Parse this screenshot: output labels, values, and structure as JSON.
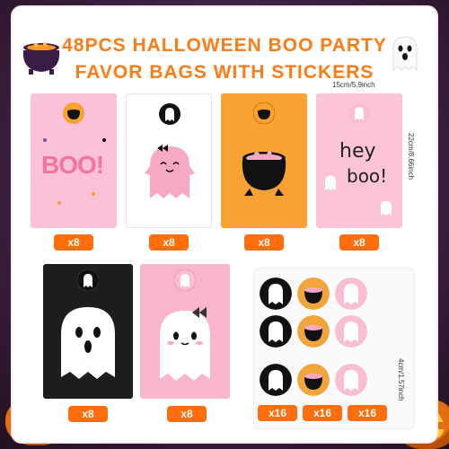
{
  "title": {
    "line1": "48PCS HALLOWEEN BOO PARTY",
    "line2": "FAVOR BAGS WITH STICKERS"
  },
  "dimensions": {
    "width": "15cm/5.9inch",
    "height": "22cm/8.66inch",
    "sticker": "4cm/1.57inch"
  },
  "bags_row1": [
    {
      "design": "boo-text",
      "color": "#fbc1d8",
      "qty": "x8"
    },
    {
      "design": "ghost-bow",
      "color": "#ffffff",
      "qty": "x8"
    },
    {
      "design": "cauldron",
      "color": "#f7a233",
      "qty": "x8"
    },
    {
      "design": "hey-boo",
      "color": "#fbc5d7",
      "qty": "x8"
    }
  ],
  "bag_texts": {
    "boo": "BOO!",
    "hey": "hey",
    "boo2": "boo!"
  },
  "bags_row2": [
    {
      "design": "ghost-black",
      "color": "#1d1d1d",
      "qty": "x8"
    },
    {
      "design": "ghost-pink",
      "color": "#f8b6cc",
      "qty": "x8"
    }
  ],
  "stickers": [
    {
      "design": "ghost",
      "color": "#111111",
      "qty": "x16"
    },
    {
      "design": "cauldron",
      "color": "#f2a53a",
      "qty": "x16"
    },
    {
      "design": "ghost-bow",
      "color": "#f9bed2",
      "qty": "x16"
    }
  ],
  "colors": {
    "accent": "#ff6d0c",
    "title": "#ff7b15"
  }
}
